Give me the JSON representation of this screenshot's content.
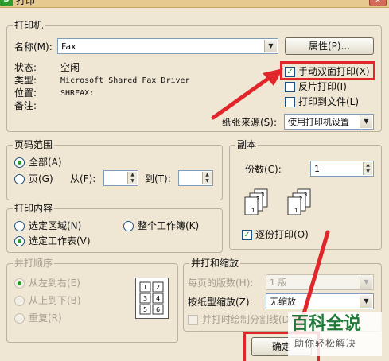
{
  "window": {
    "app_icon": "S",
    "title": "打印",
    "close_label": "×"
  },
  "printer": {
    "legend": "打印机",
    "name_label": "名称(M):",
    "name_value": "Fax",
    "properties_button": "属性(P)...",
    "status_label": "状态:",
    "status_value": "空闲",
    "type_label": "类型:",
    "type_value": "Microsoft Shared Fax Driver",
    "location_label": "位置:",
    "location_value": "SHRFAX:",
    "comment_label": "备注:",
    "duplex_label": "手动双面打印(X)",
    "duplex_checked": true,
    "reverse_label": "反片打印(I)",
    "reverse_checked": false,
    "tofile_label": "打印到文件(L)",
    "tofile_checked": false,
    "source_label": "纸张来源(S):",
    "source_value": "使用打印机设置"
  },
  "page_range": {
    "legend": "页码范围",
    "all_label": "全部(A)",
    "all_selected": true,
    "pages_label": "页(G)",
    "from_label": "从(F):",
    "to_label": "到(T):"
  },
  "copies": {
    "legend": "副本",
    "count_label": "份数(C):",
    "count_value": "1",
    "collate_label": "逐份打印(O)",
    "collate_checked": true,
    "stack_a": [
      "3",
      "2",
      "1"
    ],
    "stack_b": [
      "3",
      "2",
      "1"
    ]
  },
  "print_content": {
    "legend": "打印内容",
    "selection_label": "选定区域(N)",
    "workbook_label": "整个工作簿(K)",
    "sheet_label": "选定工作表(V)",
    "sheet_selected": true
  },
  "order": {
    "legend": "并打顺序",
    "ltr_label": "从左到右(E)",
    "ttb_label": "从上到下(B)",
    "repeat_label": "重复(R)",
    "grid": [
      "1",
      "2",
      "3",
      "4",
      "5",
      "6"
    ]
  },
  "combine": {
    "legend": "并打和缩放",
    "per_page_label": "每页的版数(H):",
    "per_page_value": "1 版",
    "scale_label": "按纸型缩放(Z):",
    "scale_value": "无缩放",
    "draw_borders_label": "并打时绘制分割线(D)"
  },
  "ok_button": "确定",
  "watermark": {
    "title": "百科全说",
    "subtitle": "助你轻松解决"
  },
  "colors": {
    "highlight": "#e0262b",
    "background": "#efe6d4"
  }
}
